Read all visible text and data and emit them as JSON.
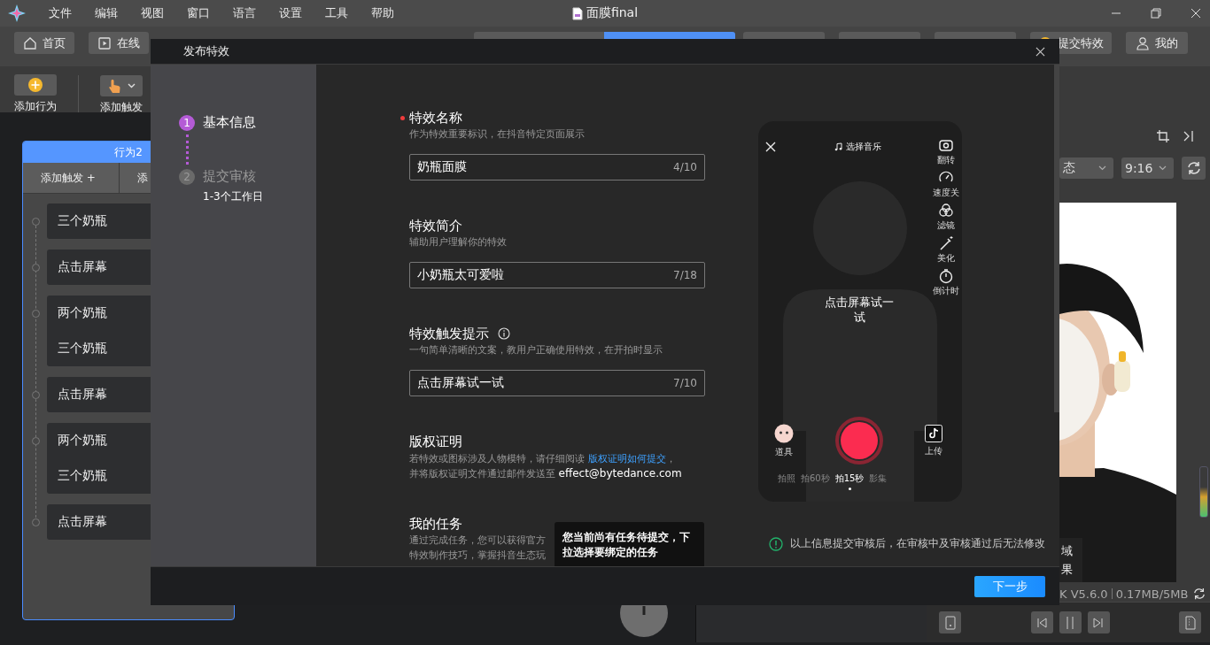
{
  "menu_bar": {
    "items": [
      "文件",
      "编辑",
      "视图",
      "窗口",
      "语言",
      "设置",
      "工具",
      "帮助"
    ],
    "title": "面膜final"
  },
  "toolbar": {
    "left": [
      {
        "label": "首页",
        "kind": "home"
      },
      {
        "label": "在线",
        "kind": "tutorial"
      }
    ],
    "right": [
      {
        "label": "提交特效",
        "kind": "submit"
      },
      {
        "label": "我的",
        "kind": "profile"
      }
    ]
  },
  "actions": [
    {
      "label": "添加行为",
      "kind": "behavior"
    },
    {
      "label": "添加触发",
      "kind": "trigger"
    }
  ],
  "behavior_node": {
    "title": "行为2",
    "tabs": [
      "添加触发 +",
      "添"
    ],
    "groups": [
      {
        "items": [
          "三个奶瓶"
        ]
      },
      {
        "items": [
          "点击屏幕"
        ]
      },
      {
        "items": [
          "两个奶瓶",
          "三个奶瓶"
        ]
      },
      {
        "items": [
          "点击屏幕"
        ]
      },
      {
        "items": [
          "两个奶瓶",
          "三个奶瓶"
        ]
      },
      {
        "items": [
          "点击屏幕"
        ]
      }
    ]
  },
  "preview": {
    "mode": "态",
    "ratio": "9:16",
    "overlay_lines": [
      "域",
      "果"
    ],
    "version": "K V5.6.0",
    "size": "0.17MB/5MB"
  },
  "dialog": {
    "title": "发布特效",
    "steps": [
      {
        "number": "1",
        "label": "基本信息",
        "selected": true
      },
      {
        "number": "2",
        "label": "提交审核",
        "note": "1-3个工作日",
        "selected": false
      }
    ],
    "fields": [
      {
        "label": "特效名称",
        "required": true,
        "info": false,
        "hint": "作为特效重要标识，在抖音特定页面展示",
        "value": "奶瓶面膜",
        "count": "4/10"
      },
      {
        "label": "特效简介",
        "required": false,
        "info": false,
        "hint": "辅助用户理解你的特效",
        "value": "小奶瓶太可爱啦",
        "count": "7/18"
      },
      {
        "label": "特效触发提示",
        "required": false,
        "info": true,
        "hint": "一句简单清晰的文案，教用户正确使用特效，在开拍时显示",
        "value": "点击屏幕试一试",
        "count": "7/10"
      }
    ],
    "copyright": {
      "title": "版权证明",
      "before": "若特效或图标涉及人物模特，请仔细阅读 ",
      "link": "版权证明如何提交",
      "after": "，",
      "line2": "并将版权证明文件通过邮件发送至 ",
      "email": "effect@bytedance.com"
    },
    "tasks": {
      "title": "我的任务",
      "lines": [
        "通过完成任务，您可以获得官方",
        "特效制作技巧，掌握抖音生态玩"
      ]
    },
    "tooltip": "您当前尚有任务待提交，下拉选择要绑定的任务",
    "phone": {
      "music": "选择音乐",
      "tools": [
        {
          "label": "翻转",
          "kind": "flip"
        },
        {
          "label": "速度关",
          "kind": "speed"
        },
        {
          "label": "滤镜",
          "kind": "filter"
        },
        {
          "label": "美化",
          "kind": "beauty"
        },
        {
          "label": "倒计时",
          "kind": "timer"
        }
      ],
      "hint": "点击屏幕试一试",
      "props": "道具",
      "upload": "上传",
      "modes": [
        {
          "label": "拍照",
          "selected": false
        },
        {
          "label": "拍60秒",
          "selected": false
        },
        {
          "label": "拍15秒",
          "selected": true
        },
        {
          "label": "影集",
          "selected": false
        }
      ]
    },
    "notice": "以上信息提交审核后，在审核中及审核通过后无法修改",
    "next_button": "下一步"
  }
}
